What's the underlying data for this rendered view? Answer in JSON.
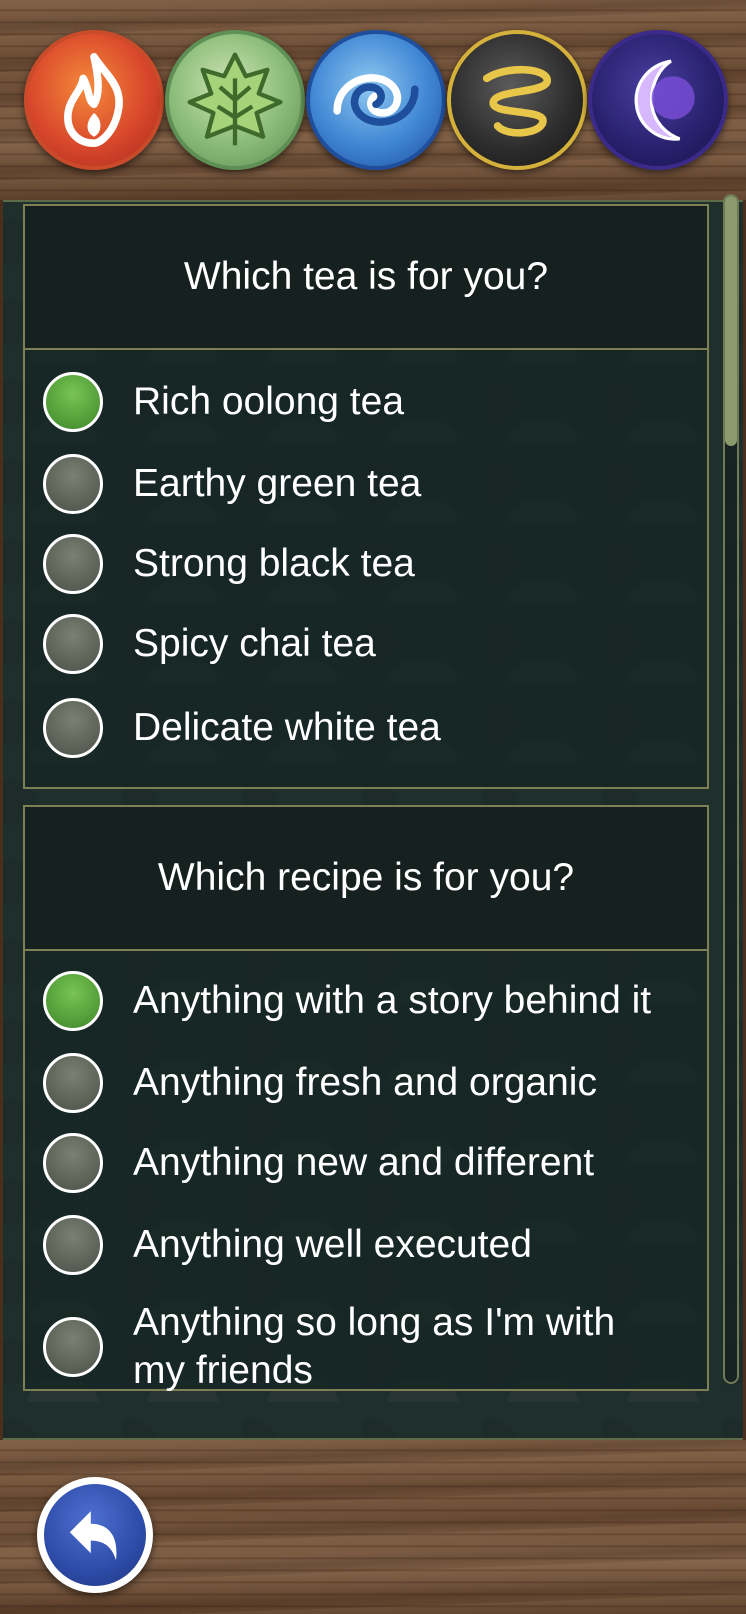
{
  "header": {
    "elements": [
      {
        "name": "fire",
        "icon": "fire-icon",
        "color": "#d9482c"
      },
      {
        "name": "earth",
        "icon": "leaf-icon",
        "color": "#8fbf7c"
      },
      {
        "name": "water",
        "icon": "water-swirl-icon",
        "color": "#3f86d4"
      },
      {
        "name": "air",
        "icon": "air-swirl-icon",
        "color": "#d4b13b"
      },
      {
        "name": "spirit",
        "icon": "moon-icon",
        "color": "#3b2a8a"
      }
    ]
  },
  "questions": [
    {
      "title": "Which tea is for you?",
      "options": [
        {
          "label": "Rich oolong tea",
          "selected": true
        },
        {
          "label": "Earthy green tea",
          "selected": false
        },
        {
          "label": "Strong black tea",
          "selected": false
        },
        {
          "label": "Spicy chai tea",
          "selected": false
        },
        {
          "label": "Delicate white tea",
          "selected": false
        }
      ]
    },
    {
      "title": "Which recipe is for you?",
      "options": [
        {
          "label": "Anything with a story behind it",
          "selected": true
        },
        {
          "label": "Anything fresh and organic",
          "selected": false
        },
        {
          "label": "Anything new and different",
          "selected": false
        },
        {
          "label": "Anything well executed",
          "selected": false
        },
        {
          "label": "Anything so long as I'm with my friends",
          "selected": false
        }
      ]
    }
  ],
  "footer": {
    "back_icon": "back-arrow-icon"
  },
  "colors": {
    "selected": "#4f9a36",
    "unselected": "#5a5f55",
    "panel": "#1f2f2c",
    "accent_border": "#7d7f55"
  }
}
